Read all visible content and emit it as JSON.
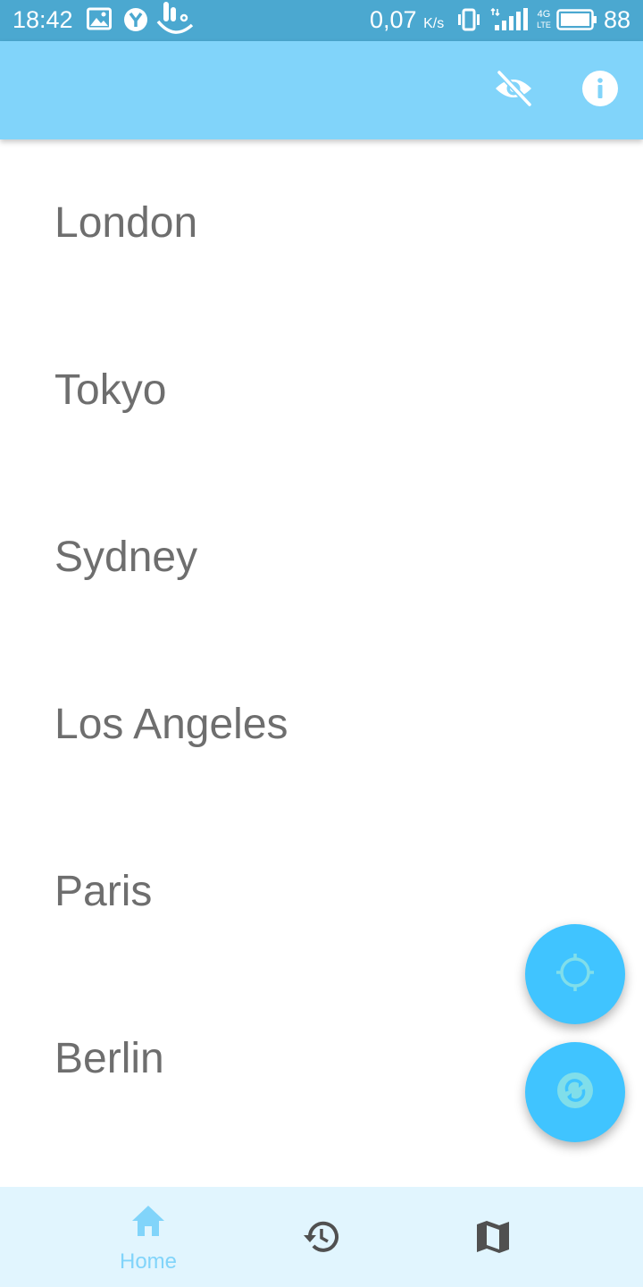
{
  "status_bar": {
    "time": "18:42",
    "speed_value": "0,07",
    "speed_unit": "K/s",
    "network_type": "4G",
    "network_sub": "LTE",
    "battery": "88",
    "icons": [
      "gallery-icon",
      "yandex-icon",
      "gesture-icon",
      "vibrate-icon",
      "signal-icon",
      "battery-icon"
    ]
  },
  "app_bar": {
    "actions": [
      {
        "name": "visibility-off-icon"
      },
      {
        "name": "info-icon"
      }
    ]
  },
  "cities": [
    {
      "label": "London"
    },
    {
      "label": "Tokyo"
    },
    {
      "label": "Sydney"
    },
    {
      "label": "Los Angeles"
    },
    {
      "label": "Paris"
    },
    {
      "label": "Berlin"
    }
  ],
  "fabs": [
    {
      "name": "locate-button",
      "icon": "crosshair-icon"
    },
    {
      "name": "refresh-button",
      "icon": "sync-icon"
    }
  ],
  "bottom_nav": {
    "items": [
      {
        "label": "Home",
        "icon": "home-icon",
        "active": true
      },
      {
        "label": "",
        "icon": "history-icon",
        "active": false
      },
      {
        "label": "",
        "icon": "map-icon",
        "active": false
      }
    ]
  },
  "colors": {
    "status_bar": "#4ba8d0",
    "app_bar": "#81d4fa",
    "fab": "#40c4ff",
    "fab_icon": "#80deea",
    "bottom_nav": "#e1f5fe",
    "active_nav": "#81d4fa",
    "inactive_nav_icon": "#505050",
    "list_text": "#6e6e6e"
  }
}
